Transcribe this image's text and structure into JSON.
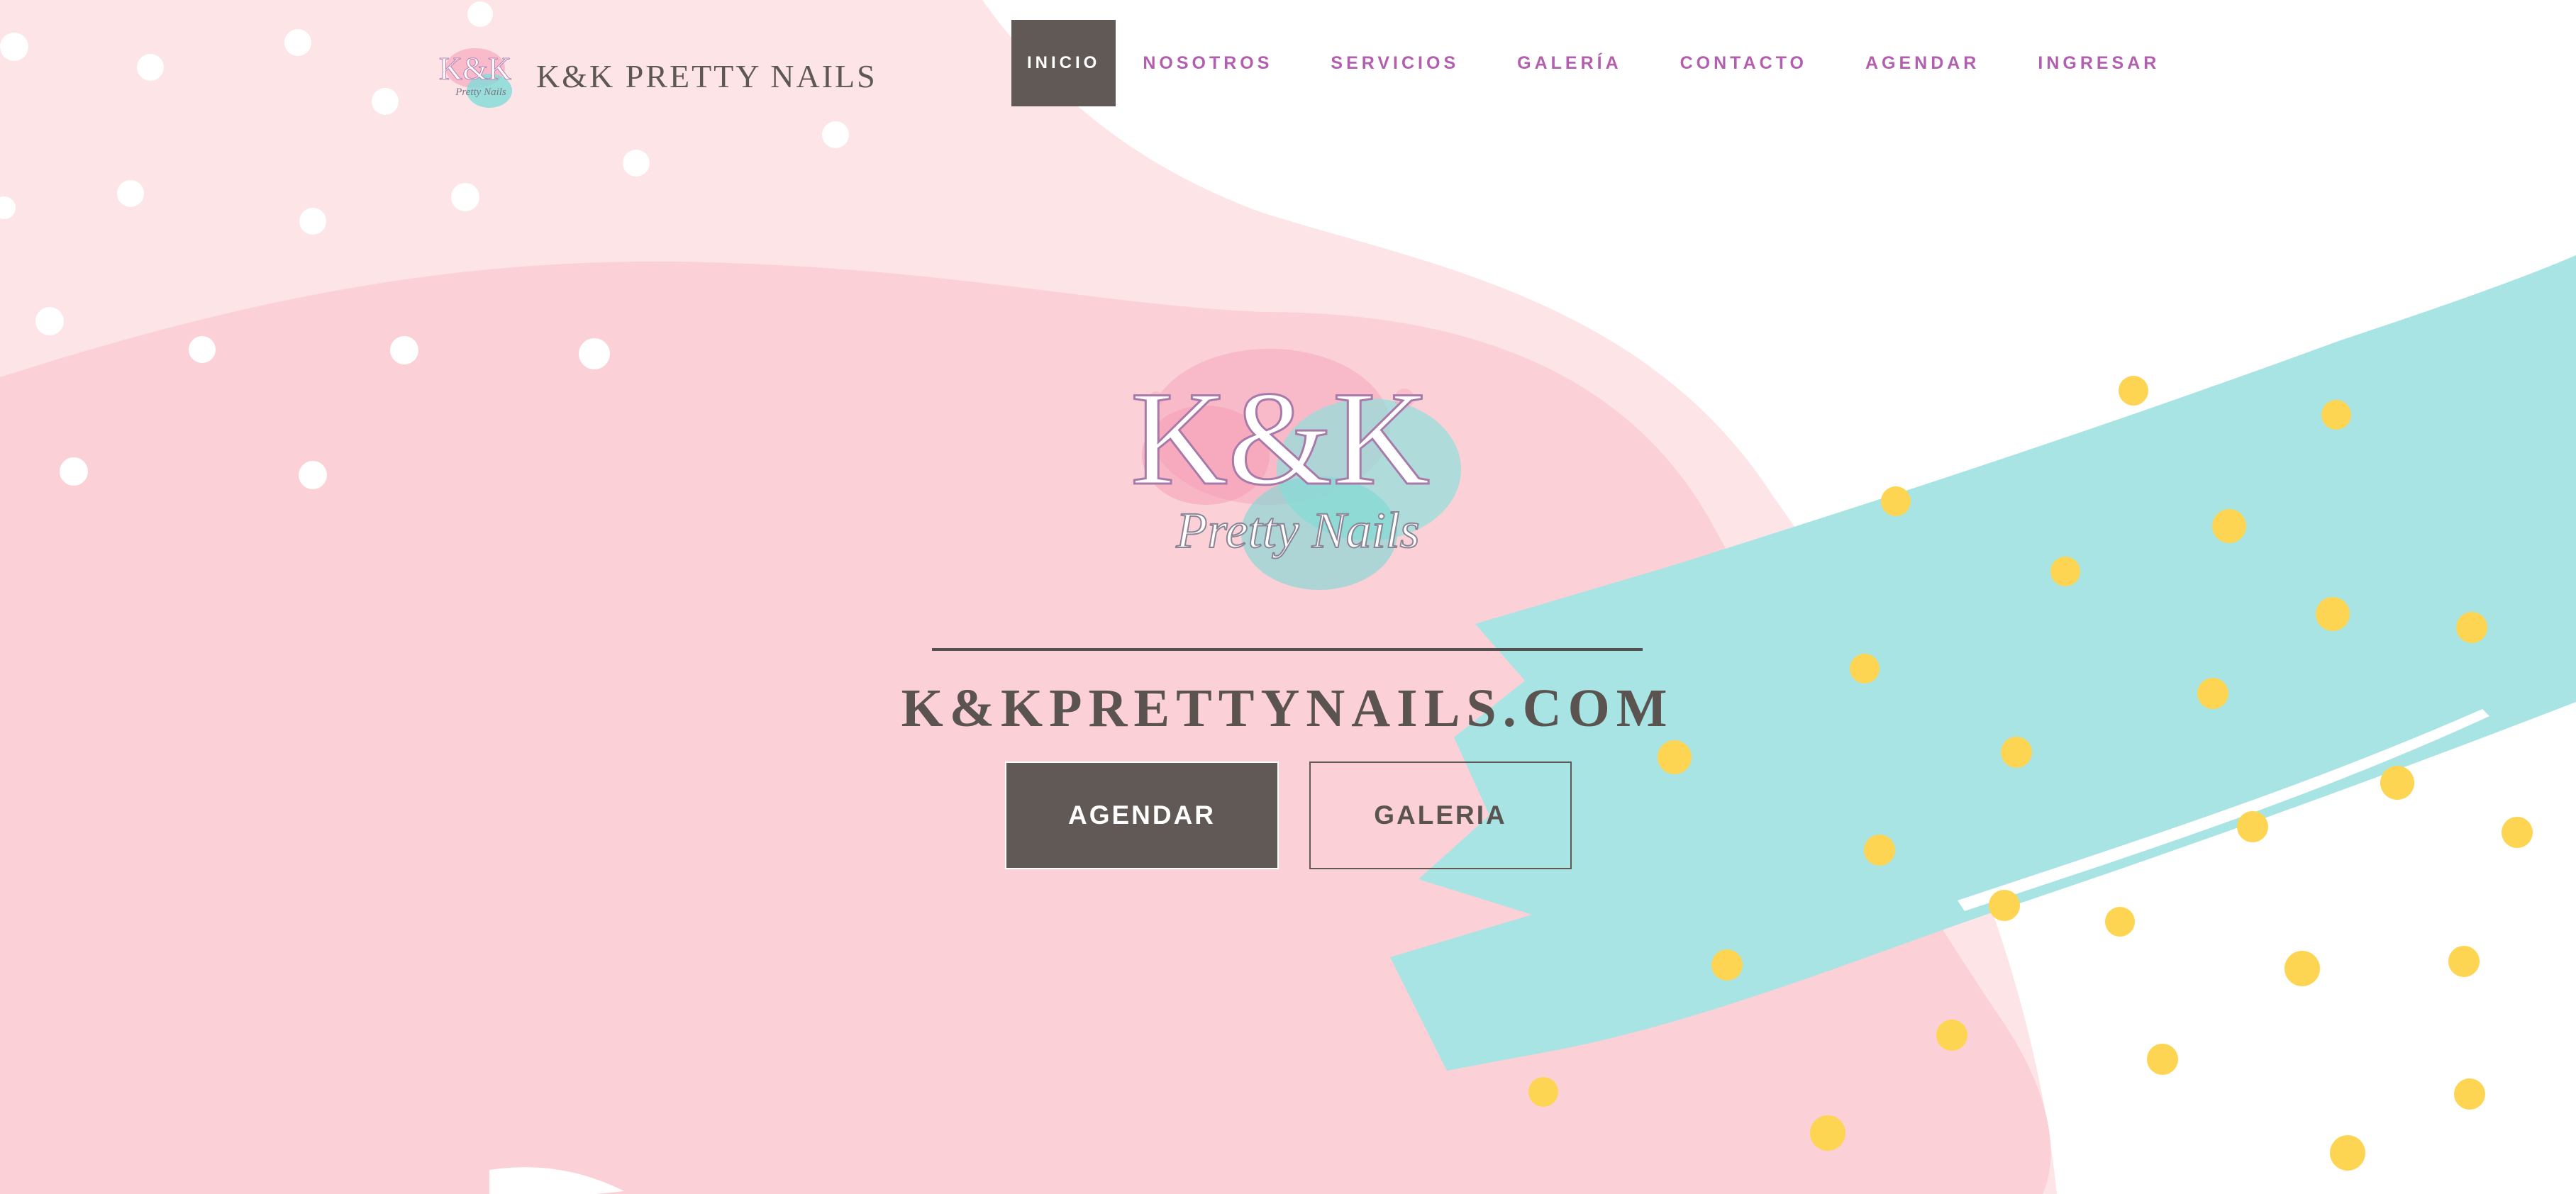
{
  "brand": {
    "name": "K&K PRETTY NAILS",
    "logo_text": "K&K",
    "logo_script": "Pretty Nails"
  },
  "nav": {
    "items": [
      {
        "label": "INICIO",
        "active": true
      },
      {
        "label": "NOSOTROS",
        "active": false
      },
      {
        "label": "SERVICIOS",
        "active": false
      },
      {
        "label": "GALERÍA",
        "active": false
      },
      {
        "label": "CONTACTO",
        "active": false
      },
      {
        "label": "AGENDAR",
        "active": false
      },
      {
        "label": "INGRESAR",
        "active": false
      }
    ]
  },
  "hero": {
    "logo_text": "K&K",
    "logo_script": "Pretty Nails",
    "site_title": "K&KPRETTYNAILS.COM",
    "primary_button": "AGENDAR",
    "secondary_button": "GALERIA"
  },
  "colors": {
    "background": "#ffffff",
    "pink_light": "#fde4e7",
    "pink": "#fbd0d6",
    "teal_brush": "#a8e4e3",
    "yellow_dots": "#fdd553",
    "nav_text": "#b35fb0",
    "dark": "#605955"
  },
  "icons": [
    "brand-logo-icon",
    "hero-logo-icon"
  ]
}
